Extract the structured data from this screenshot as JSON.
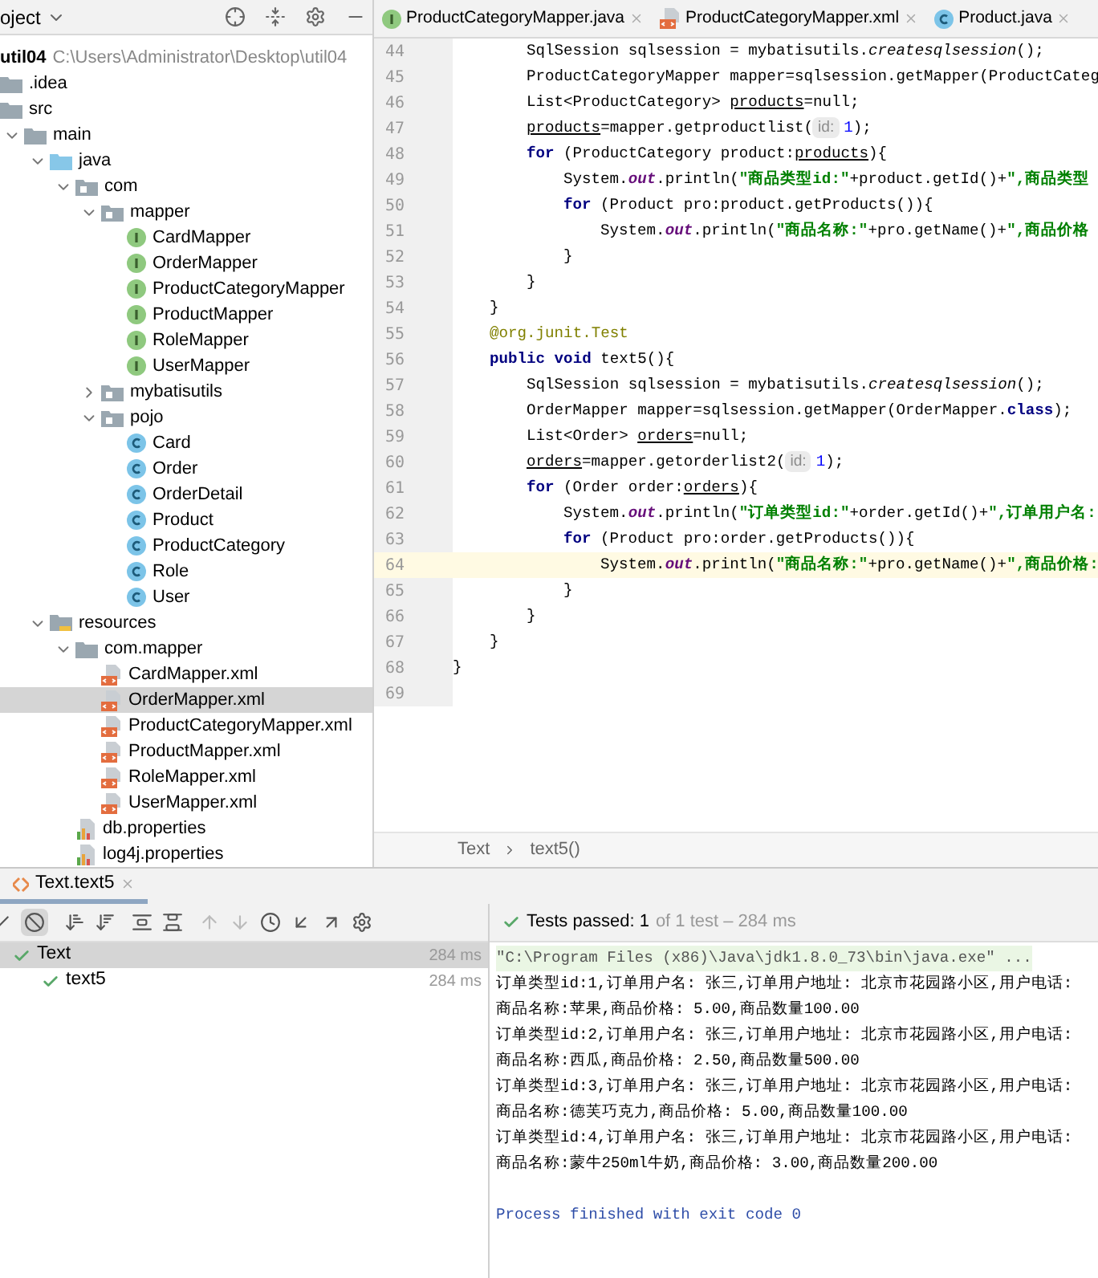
{
  "project_panel": {
    "title": "oject",
    "root": {
      "label": "util04",
      "path": "C:\\Users\\Administrator\\Desktop\\util04"
    },
    "tree": [
      {
        "label": ".idea",
        "kind": "folder",
        "selected": false
      },
      {
        "label": "src",
        "kind": "folder",
        "selected": false,
        "children": [
          {
            "label": "main",
            "kind": "folder",
            "expanded": true,
            "selected": false,
            "children": [
              {
                "label": "java",
                "kind": "source",
                "expanded": true,
                "selected": false,
                "children": [
                  {
                    "label": "com",
                    "kind": "package",
                    "expanded": true,
                    "selected": false,
                    "children": [
                      {
                        "label": "mapper",
                        "kind": "package",
                        "expanded": true,
                        "selected": false,
                        "children": [
                          {
                            "label": "CardMapper",
                            "kind": "interface",
                            "selected": false
                          },
                          {
                            "label": "OrderMapper",
                            "kind": "interface",
                            "selected": false
                          },
                          {
                            "label": "ProductCategoryMapper",
                            "kind": "interface",
                            "selected": false
                          },
                          {
                            "label": "ProductMapper",
                            "kind": "interface",
                            "selected": false
                          },
                          {
                            "label": "RoleMapper",
                            "kind": "interface",
                            "selected": false
                          },
                          {
                            "label": "UserMapper",
                            "kind": "interface",
                            "selected": false
                          }
                        ]
                      },
                      {
                        "label": "mybatisutils",
                        "kind": "package",
                        "expanded": false,
                        "selected": false
                      },
                      {
                        "label": "pojo",
                        "kind": "package",
                        "expanded": true,
                        "selected": false,
                        "children": [
                          {
                            "label": "Card",
                            "kind": "class",
                            "selected": false
                          },
                          {
                            "label": "Order",
                            "kind": "class",
                            "selected": false
                          },
                          {
                            "label": "OrderDetail",
                            "kind": "class",
                            "selected": false
                          },
                          {
                            "label": "Product",
                            "kind": "class",
                            "selected": false
                          },
                          {
                            "label": "ProductCategory",
                            "kind": "class",
                            "selected": false
                          },
                          {
                            "label": "Role",
                            "kind": "class",
                            "selected": false
                          },
                          {
                            "label": "User",
                            "kind": "class",
                            "selected": false
                          }
                        ]
                      }
                    ]
                  }
                ]
              },
              {
                "label": "resources",
                "kind": "resources",
                "expanded": true,
                "selected": false,
                "children": [
                  {
                    "label": "com.mapper",
                    "kind": "folder",
                    "expanded": true,
                    "selected": false,
                    "children": [
                      {
                        "label": "CardMapper.xml",
                        "kind": "xml",
                        "selected": false
                      },
                      {
                        "label": "OrderMapper.xml",
                        "kind": "xml",
                        "selected": true
                      },
                      {
                        "label": "ProductCategoryMapper.xml",
                        "kind": "xml",
                        "selected": false
                      },
                      {
                        "label": "ProductMapper.xml",
                        "kind": "xml",
                        "selected": false
                      },
                      {
                        "label": "RoleMapper.xml",
                        "kind": "xml",
                        "selected": false
                      },
                      {
                        "label": "UserMapper.xml",
                        "kind": "xml",
                        "selected": false
                      }
                    ]
                  },
                  {
                    "label": "db.properties",
                    "kind": "properties",
                    "selected": false
                  },
                  {
                    "label": "log4j.properties",
                    "kind": "properties",
                    "selected": false
                  }
                ]
              }
            ]
          }
        ]
      }
    ]
  },
  "editor": {
    "tabs": [
      {
        "label": "ProductCategoryMapper.java",
        "kind": "interface"
      },
      {
        "label": "ProductCategoryMapper.xml",
        "kind": "xml"
      },
      {
        "label": "Product.java",
        "kind": "class"
      }
    ],
    "lines": [
      {
        "number": "44",
        "current": false,
        "tokens": [
          {
            "kind": "plain",
            "text": "SqlSession sqlsession = mybatisutils."
          },
          {
            "kind": "static_method",
            "text": "createsqlsession"
          },
          {
            "kind": "plain",
            "text": "();"
          }
        ]
      },
      {
        "number": "45",
        "current": false,
        "tokens": [
          {
            "kind": "plain",
            "text": "ProductCategoryMapper mapper=sqlsession.getMapper(ProductCateg"
          }
        ]
      },
      {
        "number": "46",
        "current": false,
        "tokens": [
          {
            "kind": "plain",
            "text": "List<ProductCategory> "
          },
          {
            "kind": "variable",
            "text": "products"
          },
          {
            "kind": "plain",
            "text": "=null;"
          }
        ]
      },
      {
        "number": "47",
        "current": false,
        "tokens": [
          {
            "kind": "variable",
            "text": "products"
          },
          {
            "kind": "plain",
            "text": "=mapper.getproductlist("
          },
          {
            "kind": "hint",
            "text": "id:"
          },
          {
            "kind": "number",
            "text": "1"
          },
          {
            "kind": "plain",
            "text": ");"
          }
        ]
      },
      {
        "number": "48",
        "current": false,
        "tokens": [
          {
            "kind": "keyword",
            "text": "for"
          },
          {
            "kind": "plain",
            "text": " (ProductCategory product:"
          },
          {
            "kind": "variable",
            "text": "products"
          },
          {
            "kind": "plain",
            "text": "){"
          }
        ]
      },
      {
        "number": "49",
        "current": false,
        "tokens": [
          {
            "kind": "plain",
            "text": "System."
          },
          {
            "kind": "static_field",
            "text": "out"
          },
          {
            "kind": "plain",
            "text": ".println("
          },
          {
            "kind": "string",
            "text": "\"商品类型id:\""
          },
          {
            "kind": "plain",
            "text": "+product.getId()+"
          },
          {
            "kind": "string",
            "text": "\",商品类型"
          }
        ]
      },
      {
        "number": "50",
        "current": false,
        "tokens": [
          {
            "kind": "keyword",
            "text": "for"
          },
          {
            "kind": "plain",
            "text": " (Product pro:product.getProducts()){"
          }
        ]
      },
      {
        "number": "51",
        "current": false,
        "tokens": [
          {
            "kind": "plain",
            "text": "System."
          },
          {
            "kind": "static_field",
            "text": "out"
          },
          {
            "kind": "plain",
            "text": ".println("
          },
          {
            "kind": "string",
            "text": "\"商品名称:\""
          },
          {
            "kind": "plain",
            "text": "+pro.getName()+"
          },
          {
            "kind": "string",
            "text": "\",商品价格"
          }
        ]
      },
      {
        "number": "52",
        "current": false,
        "tokens": [
          {
            "kind": "plain",
            "text": "}"
          }
        ]
      },
      {
        "number": "53",
        "current": false,
        "tokens": [
          {
            "kind": "plain",
            "text": "}"
          }
        ]
      },
      {
        "number": "54",
        "current": false,
        "tokens": [
          {
            "kind": "plain",
            "text": "}"
          }
        ]
      },
      {
        "number": "55",
        "current": false,
        "tokens": [
          {
            "kind": "annotation",
            "text": "@org.junit.Test"
          }
        ]
      },
      {
        "number": "56",
        "current": false,
        "tokens": [
          {
            "kind": "keyword",
            "text": "public void"
          },
          {
            "kind": "plain",
            "text": " text5(){"
          }
        ]
      },
      {
        "number": "57",
        "current": false,
        "tokens": [
          {
            "kind": "plain",
            "text": "SqlSession sqlsession = mybatisutils."
          },
          {
            "kind": "static_method",
            "text": "createsqlsession"
          },
          {
            "kind": "plain",
            "text": "();"
          }
        ]
      },
      {
        "number": "58",
        "current": false,
        "tokens": [
          {
            "kind": "plain",
            "text": "OrderMapper mapper=sqlsession.getMapper(OrderMapper."
          },
          {
            "kind": "keyword",
            "text": "class"
          },
          {
            "kind": "plain",
            "text": ");"
          }
        ]
      },
      {
        "number": "59",
        "current": false,
        "tokens": [
          {
            "kind": "plain",
            "text": "List<Order> "
          },
          {
            "kind": "variable",
            "text": "orders"
          },
          {
            "kind": "plain",
            "text": "=null;"
          }
        ]
      },
      {
        "number": "60",
        "current": false,
        "tokens": [
          {
            "kind": "variable",
            "text": "orders"
          },
          {
            "kind": "plain",
            "text": "=mapper.getorderlist2("
          },
          {
            "kind": "hint",
            "text": "id:"
          },
          {
            "kind": "number",
            "text": "1"
          },
          {
            "kind": "plain",
            "text": ");"
          }
        ]
      },
      {
        "number": "61",
        "current": false,
        "tokens": [
          {
            "kind": "keyword",
            "text": "for"
          },
          {
            "kind": "plain",
            "text": " (Order order:"
          },
          {
            "kind": "variable",
            "text": "orders"
          },
          {
            "kind": "plain",
            "text": "){"
          }
        ]
      },
      {
        "number": "62",
        "current": false,
        "tokens": [
          {
            "kind": "plain",
            "text": "System."
          },
          {
            "kind": "static_field",
            "text": "out"
          },
          {
            "kind": "plain",
            "text": ".println("
          },
          {
            "kind": "string",
            "text": "\"订单类型id:\""
          },
          {
            "kind": "plain",
            "text": "+order.getId()+"
          },
          {
            "kind": "string",
            "text": "\",订单用户名:"
          }
        ]
      },
      {
        "number": "63",
        "current": false,
        "tokens": [
          {
            "kind": "keyword",
            "text": "for"
          },
          {
            "kind": "plain",
            "text": " (Product pro:order.getProducts()){"
          }
        ]
      },
      {
        "number": "64",
        "current": true,
        "tokens": [
          {
            "kind": "plain",
            "text": "System."
          },
          {
            "kind": "static_field",
            "text": "out"
          },
          {
            "kind": "plain",
            "text": ".println("
          },
          {
            "kind": "string",
            "text": "\"商品名称:\""
          },
          {
            "kind": "plain",
            "text": "+pro.getName()+"
          },
          {
            "kind": "string",
            "text": "\",商品价格:"
          }
        ]
      },
      {
        "number": "65",
        "current": false,
        "tokens": [
          {
            "kind": "plain",
            "text": "}"
          }
        ]
      },
      {
        "number": "66",
        "current": false,
        "tokens": [
          {
            "kind": "plain",
            "text": "}"
          }
        ]
      },
      {
        "number": "67",
        "current": false,
        "tokens": [
          {
            "kind": "plain",
            "text": "}"
          }
        ]
      },
      {
        "number": "68",
        "current": false,
        "tokens": [
          {
            "kind": "plain",
            "text": "}"
          }
        ]
      },
      {
        "number": "69",
        "current": false
      }
    ],
    "breadcrumb": [
      "Text",
      "text5()"
    ]
  },
  "run_panel": {
    "tab": "Text.text5",
    "tests": [
      {
        "label": "Text",
        "time": "284 ms",
        "selected": true,
        "passed": true,
        "children": [
          {
            "label": "text5",
            "time": "284 ms",
            "selected": false,
            "passed": true
          }
        ]
      }
    ],
    "status": {
      "passed": "Tests passed: 1",
      "rest": "of 1 test – 284 ms"
    },
    "console": [
      {
        "kind": "command",
        "text": "\"C:\\Program Files (x86)\\Java\\jdk1.8.0_73\\bin\\java.exe\" ..."
      },
      {
        "kind": "output",
        "text": "订单类型id:1,订单用户名: 张三,订单用户地址: 北京市花园路小区,用户电话:"
      },
      {
        "kind": "output",
        "text": "商品名称:苹果,商品价格: 5.00,商品数量100.00"
      },
      {
        "kind": "output",
        "text": "订单类型id:2,订单用户名: 张三,订单用户地址: 北京市花园路小区,用户电话:"
      },
      {
        "kind": "output",
        "text": "商品名称:西瓜,商品价格: 2.50,商品数量500.00"
      },
      {
        "kind": "output",
        "text": "订单类型id:3,订单用户名: 张三,订单用户地址: 北京市花园路小区,用户电话:"
      },
      {
        "kind": "output",
        "text": "商品名称:德芙巧克力,商品价格: 5.00,商品数量100.00"
      },
      {
        "kind": "output",
        "text": "订单类型id:4,订单用户名: 张三,订单用户地址: 北京市花园路小区,用户电话:"
      },
      {
        "kind": "output",
        "text": "商品名称:蒙牛250ml牛奶,商品价格: 3.00,商品数量200.00"
      },
      {
        "kind": "blank"
      },
      {
        "kind": "exit",
        "text": "Process finished with exit code 0"
      }
    ]
  }
}
